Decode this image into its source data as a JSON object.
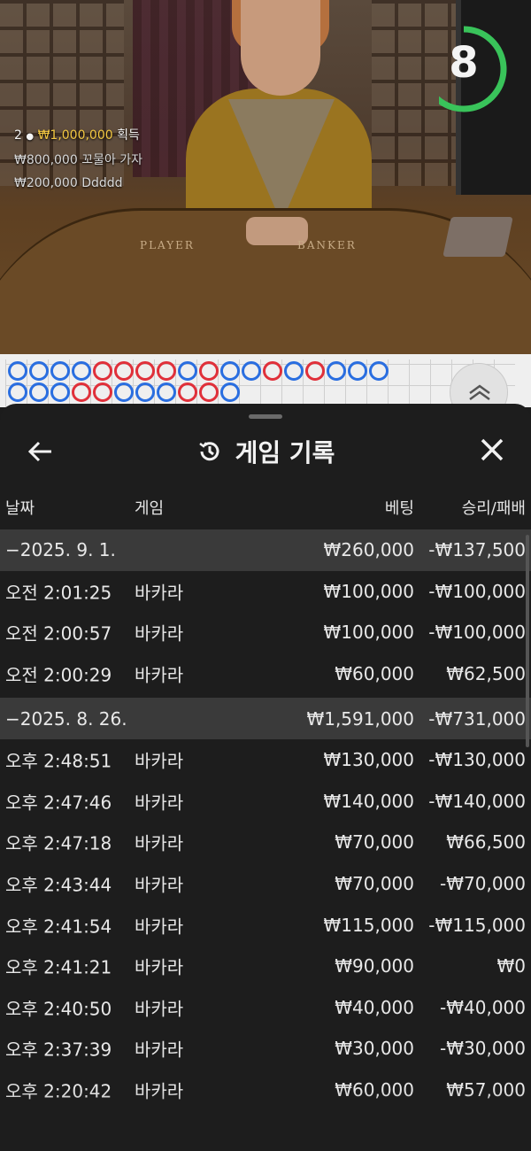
{
  "video": {
    "player_label": "PLAYER",
    "banker_label": "BANKER",
    "timer": "8",
    "timer_progress": 0.72,
    "winners": [
      {
        "rank": "2",
        "amount": "₩1,000,000",
        "suffix": "획득"
      },
      {
        "amount": "₩800,000",
        "name": "꼬물아 가자"
      },
      {
        "amount": "₩200,000",
        "name": "Ddddd"
      }
    ]
  },
  "road": {
    "beads_top": [
      "b",
      "b",
      "b",
      "b",
      "r",
      "r",
      "r",
      "r",
      "b",
      "r",
      "b",
      "b",
      "r",
      "b",
      "r",
      "b",
      "b",
      "b"
    ],
    "beads_bottom": [
      "b",
      "b",
      "b",
      "r",
      "r",
      "b",
      "b",
      "b",
      "r",
      "r",
      "b"
    ]
  },
  "sheet": {
    "title": "게임 기록",
    "columns": {
      "date": "날짜",
      "game": "게임",
      "bet": "베팅",
      "result": "승리/패배"
    },
    "rows": [
      {
        "type": "group",
        "date": "−2025. 9. 1.",
        "bet": "₩260,000",
        "result": "-₩137,500"
      },
      {
        "type": "item",
        "date": "오전 2:01:25",
        "game": "바카라",
        "bet": "₩100,000",
        "result": "-₩100,000"
      },
      {
        "type": "item",
        "date": "오전 2:00:57",
        "game": "바카라",
        "bet": "₩100,000",
        "result": "-₩100,000"
      },
      {
        "type": "item",
        "date": "오전 2:00:29",
        "game": "바카라",
        "bet": "₩60,000",
        "result": "₩62,500"
      },
      {
        "type": "group",
        "date": "−2025. 8. 26.",
        "bet": "₩1,591,000",
        "result": "-₩731,000"
      },
      {
        "type": "item",
        "date": "오후 2:48:51",
        "game": "바카라",
        "bet": "₩130,000",
        "result": "-₩130,000"
      },
      {
        "type": "item",
        "date": "오후 2:47:46",
        "game": "바카라",
        "bet": "₩140,000",
        "result": "-₩140,000"
      },
      {
        "type": "item",
        "date": "오후 2:47:18",
        "game": "바카라",
        "bet": "₩70,000",
        "result": "₩66,500"
      },
      {
        "type": "item",
        "date": "오후 2:43:44",
        "game": "바카라",
        "bet": "₩70,000",
        "result": "-₩70,000"
      },
      {
        "type": "item",
        "date": "오후 2:41:54",
        "game": "바카라",
        "bet": "₩115,000",
        "result": "-₩115,000"
      },
      {
        "type": "item",
        "date": "오후 2:41:21",
        "game": "바카라",
        "bet": "₩90,000",
        "result": "₩0"
      },
      {
        "type": "item",
        "date": "오후 2:40:50",
        "game": "바카라",
        "bet": "₩40,000",
        "result": "-₩40,000"
      },
      {
        "type": "item",
        "date": "오후 2:37:39",
        "game": "바카라",
        "bet": "₩30,000",
        "result": "-₩30,000"
      },
      {
        "type": "item",
        "date": "오후 2:20:42",
        "game": "바카라",
        "bet": "₩60,000",
        "result": "₩57,000"
      }
    ]
  },
  "icons": {
    "back": "arrow-left-icon",
    "close": "close-icon",
    "history": "history-icon",
    "expand": "chevron-up-icon"
  }
}
